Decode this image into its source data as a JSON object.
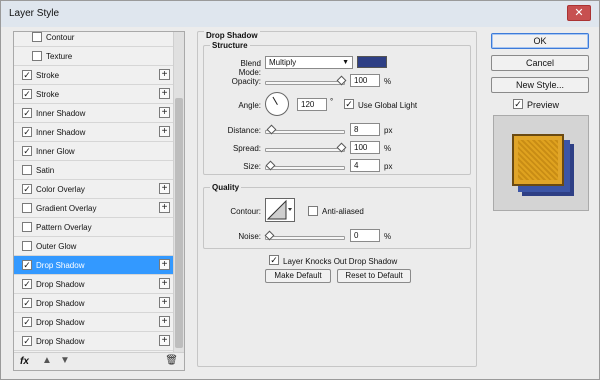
{
  "window": {
    "title": "Layer Style",
    "close_glyph": "✕"
  },
  "effects": [
    {
      "label": "Contour",
      "checked": false,
      "indent": true,
      "plus": false,
      "partial": true
    },
    {
      "label": "Texture",
      "checked": false,
      "indent": true,
      "plus": false
    },
    {
      "label": "Stroke",
      "checked": true,
      "plus": true
    },
    {
      "label": "Stroke",
      "checked": true,
      "plus": true
    },
    {
      "label": "Inner Shadow",
      "checked": true,
      "plus": true
    },
    {
      "label": "Inner Shadow",
      "checked": true,
      "plus": true
    },
    {
      "label": "Inner Glow",
      "checked": true,
      "plus": false
    },
    {
      "label": "Satin",
      "checked": false,
      "plus": false
    },
    {
      "label": "Color Overlay",
      "checked": true,
      "plus": true
    },
    {
      "label": "Gradient Overlay",
      "checked": false,
      "plus": true
    },
    {
      "label": "Pattern Overlay",
      "checked": false,
      "plus": false
    },
    {
      "label": "Outer Glow",
      "checked": false,
      "plus": false
    },
    {
      "label": "Drop Shadow",
      "checked": true,
      "plus": true,
      "selected": true
    },
    {
      "label": "Drop Shadow",
      "checked": true,
      "plus": true
    },
    {
      "label": "Drop Shadow",
      "checked": true,
      "plus": true
    },
    {
      "label": "Drop Shadow",
      "checked": true,
      "plus": true
    },
    {
      "label": "Drop Shadow",
      "checked": true,
      "plus": true
    }
  ],
  "footer": {
    "fx": "fx",
    "up": "▲",
    "down": "▼",
    "trash": "🗑"
  },
  "panel": {
    "title": "Drop Shadow",
    "structure_title": "Structure",
    "blend_mode_label": "Blend Mode:",
    "blend_mode_value": "Multiply",
    "shadow_color": "#2e3f85",
    "opacity_label": "Opacity:",
    "opacity_value": "100",
    "opacity_unit": "%",
    "opacity_fraction": 1.0,
    "angle_label": "Angle:",
    "angle_value": "120",
    "angle_unit": "°",
    "use_global_light_label": "Use Global Light",
    "use_global_light": true,
    "distance_label": "Distance:",
    "distance_value": "8",
    "distance_unit": "px",
    "distance_fraction": 0.03,
    "spread_label": "Spread:",
    "spread_value": "100",
    "spread_unit": "%",
    "spread_fraction": 1.0,
    "size_label": "Size:",
    "size_value": "4",
    "size_unit": "px",
    "size_fraction": 0.02,
    "quality_title": "Quality",
    "contour_label": "Contour:",
    "anti_aliased_label": "Anti-aliased",
    "anti_aliased": false,
    "noise_label": "Noise:",
    "noise_value": "0",
    "noise_unit": "%",
    "noise_fraction": 0.0,
    "knocks_out_label": "Layer Knocks Out Drop Shadow",
    "knocks_out": true,
    "make_default_label": "Make Default",
    "reset_default_label": "Reset to Default"
  },
  "buttons": {
    "ok": "OK",
    "cancel": "Cancel",
    "new_style": "New Style...",
    "preview_label": "Preview",
    "preview_checked": true
  }
}
